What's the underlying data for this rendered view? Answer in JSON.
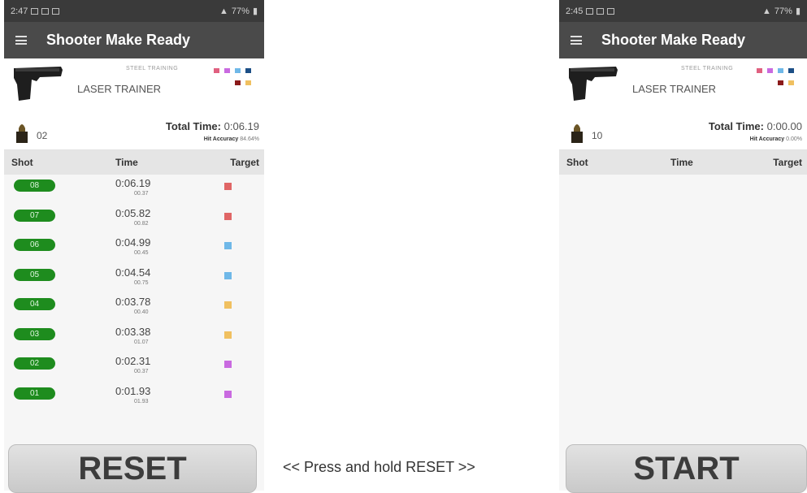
{
  "caption": "<<  Press and hold RESET >>",
  "colors": {
    "shot_pill": "#1e8c1e",
    "appbar": "#4a4a4a",
    "statusbar": "#3a3a3a"
  },
  "left": {
    "status": {
      "time": "2:47",
      "battery": "77%"
    },
    "app_title": "Shooter Make Ready",
    "profile_sub": "STEEL TRAINING",
    "profile_name": "LASER TRAINER",
    "round_count": "02",
    "total_label": "Total Time:",
    "total_value": "0:06.19",
    "accuracy_label": "Hit Accuracy",
    "accuracy_value": "84.64%",
    "columns": {
      "shot": "Shot",
      "time": "Time",
      "target": "Target"
    },
    "shots": [
      {
        "n": "08",
        "time": "0:06.19",
        "split": "00.37",
        "color": "#e06666"
      },
      {
        "n": "07",
        "time": "0:05.82",
        "split": "00.82",
        "color": "#e06666"
      },
      {
        "n": "06",
        "time": "0:04.99",
        "split": "00.45",
        "color": "#6fb8e8"
      },
      {
        "n": "05",
        "time": "0:04.54",
        "split": "00.75",
        "color": "#6fb8e8"
      },
      {
        "n": "04",
        "time": "0:03.78",
        "split": "00.40",
        "color": "#f0c060"
      },
      {
        "n": "03",
        "time": "0:03.38",
        "split": "01.07",
        "color": "#f0c060"
      },
      {
        "n": "02",
        "time": "0:02.31",
        "split": "00.37",
        "color": "#c96ae0"
      },
      {
        "n": "01",
        "time": "0:01.93",
        "split": "01.93",
        "color": "#c96ae0"
      }
    ],
    "button": "RESET"
  },
  "right": {
    "status": {
      "time": "2:45",
      "battery": "77%"
    },
    "app_title": "Shooter Make Ready",
    "profile_sub": "STEEL TRAINING",
    "profile_name": "LASER TRAINER",
    "round_count": "10",
    "total_label": "Total Time:",
    "total_value": "0:00.00",
    "accuracy_label": "Hit Accuracy",
    "accuracy_value": "0.00%",
    "columns": {
      "shot": "Shot",
      "time": "Time",
      "target": "Target"
    },
    "button": "START"
  },
  "swatch_colors": [
    "#e06080",
    "#c96ae0",
    "#6fb8e8",
    "#1c4f86",
    "#8b1a1a",
    "#f0c060"
  ]
}
